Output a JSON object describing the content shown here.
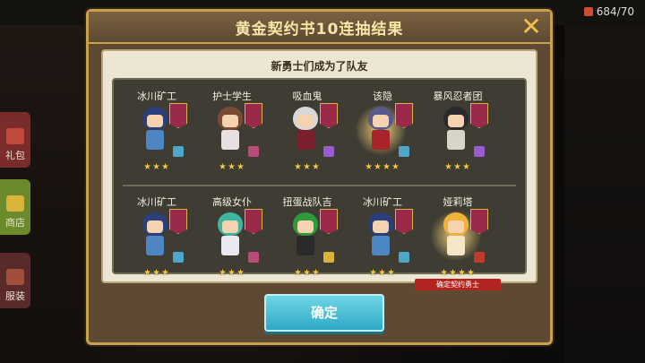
{
  "dialog": {
    "title": "黄金契约书10连抽结果",
    "subtitle": "新勇士们成为了队友",
    "confirm_label": "确定"
  },
  "resource": {
    "text": "684/70"
  },
  "sidebar": {
    "items": [
      {
        "label": "礼包"
      },
      {
        "label": "商店"
      },
      {
        "label": "服装"
      }
    ]
  },
  "heroes": [
    {
      "name": "冰川矿工",
      "stars": "★★★",
      "hair": "#2b3f7a",
      "outfit": "#4e86c4",
      "class_color": "#4ea6c9"
    },
    {
      "name": "护士学生",
      "stars": "★★★",
      "hair": "#7a4a33",
      "outfit": "#e8e0e0",
      "class_color": "#b94a7a"
    },
    {
      "name": "吸血鬼",
      "stars": "★★★",
      "hair": "#d8d8d8",
      "outfit": "#7a1f2b",
      "class_color": "#9b5bd0"
    },
    {
      "name": "该隐",
      "stars": "★★★★",
      "hair": "#5a5a8a",
      "outfit": "#a8242b",
      "class_color": "#4ea6c9",
      "special": true
    },
    {
      "name": "暴风忍者团",
      "stars": "★★★",
      "hair": "#2a2a2a",
      "outfit": "#d9d4c8",
      "class_color": "#9b5bd0"
    },
    {
      "name": "冰川矿工",
      "stars": "★★★",
      "hair": "#2b3f7a",
      "outfit": "#4e86c4",
      "class_color": "#4ea6c9"
    },
    {
      "name": "高级女仆",
      "stars": "★★★",
      "hair": "#3fb7a0",
      "outfit": "#e8e8ee",
      "class_color": "#b94a7a"
    },
    {
      "name": "扭蛋战队吉",
      "stars": "★★★",
      "hair": "#2e9a3a",
      "outfit": "#2a2a2a",
      "class_color": "#d9b33a"
    },
    {
      "name": "冰川矿工",
      "stars": "★★★",
      "hair": "#2b3f7a",
      "outfit": "#4e86c4",
      "class_color": "#4ea6c9"
    },
    {
      "name": "娅莉塔",
      "stars": "★★★★",
      "hair": "#f0b33a",
      "outfit": "#f4e6c8",
      "class_color": "#c0392b",
      "special": true,
      "ribbon": "确定契约勇士"
    }
  ]
}
